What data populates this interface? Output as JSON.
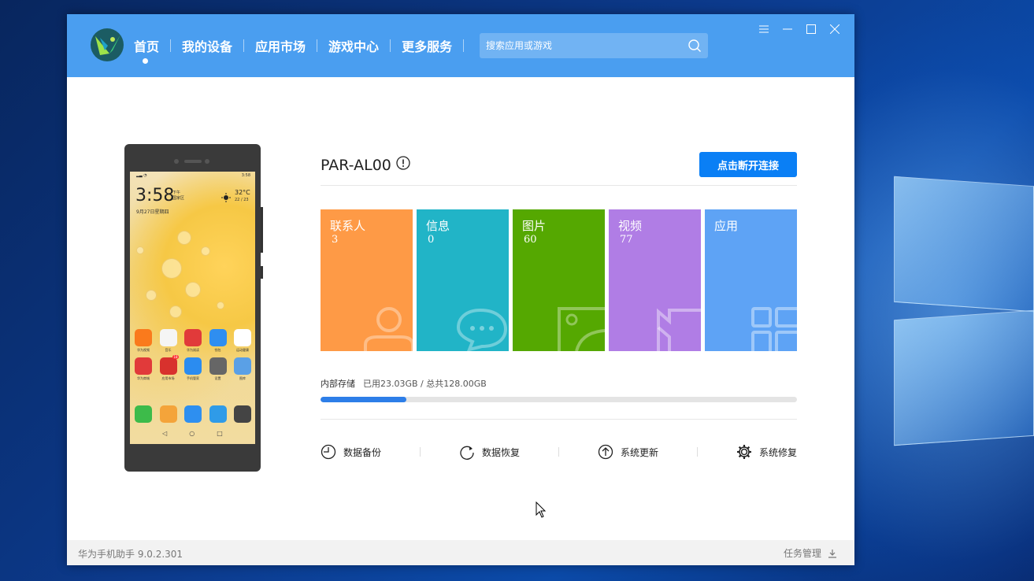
{
  "nav": {
    "items": [
      "首页",
      "我的设备",
      "应用市场",
      "游戏中心",
      "更多服务"
    ],
    "active_index": 0
  },
  "search": {
    "placeholder": "搜索应用或游戏",
    "icon": "search-icon"
  },
  "window_controls": [
    "menu-icon",
    "minimize-icon",
    "maximize-icon",
    "close-icon"
  ],
  "phone": {
    "time": "3:58",
    "ampm": "下午",
    "location": "国家区",
    "date": "9月27日星期四",
    "temp": "32°C",
    "temp_range": "22 / 23",
    "status_time": "3:58",
    "apps_row1": [
      "华为视频",
      "音乐",
      "华为阅读",
      "钱包",
      "运动健康"
    ],
    "apps_row2": [
      "华为商城",
      "应用市场",
      "手机管家",
      "设置",
      "图库"
    ],
    "badge": "18"
  },
  "device": {
    "name": "PAR-AL00",
    "info_icon": "info-icon",
    "disconnect_label": "点击断开连接"
  },
  "tiles": [
    {
      "label": "联系人",
      "count": "3",
      "color": "#fe9a46",
      "icon": "contact-icon"
    },
    {
      "label": "信息",
      "count": "0",
      "color": "#21b4c7",
      "icon": "message-icon"
    },
    {
      "label": "图片",
      "count": "60",
      "color": "#55a801",
      "icon": "picture-icon"
    },
    {
      "label": "视频",
      "count": "77",
      "color": "#b07de5",
      "icon": "video-icon"
    },
    {
      "label": "应用",
      "count": "",
      "color": "#5ea3f5",
      "icon": "apps-icon"
    }
  ],
  "storage": {
    "label": "内部存储",
    "value": "已用23.03GB / 总共128.00GB",
    "used_fraction": 0.18
  },
  "tools": [
    {
      "label": "数据备份",
      "icon": "backup-icon"
    },
    {
      "label": "数据恢复",
      "icon": "restore-icon"
    },
    {
      "label": "系统更新",
      "icon": "update-icon"
    },
    {
      "label": "系统修复",
      "icon": "repair-icon"
    }
  ],
  "footer": {
    "version": "华为手机助手 9.0.2.301",
    "task_label": "任务管理"
  },
  "colors": {
    "topbar": "#4a9ef0",
    "accent": "#0a7ff5",
    "progress": "#2d7ee8"
  }
}
